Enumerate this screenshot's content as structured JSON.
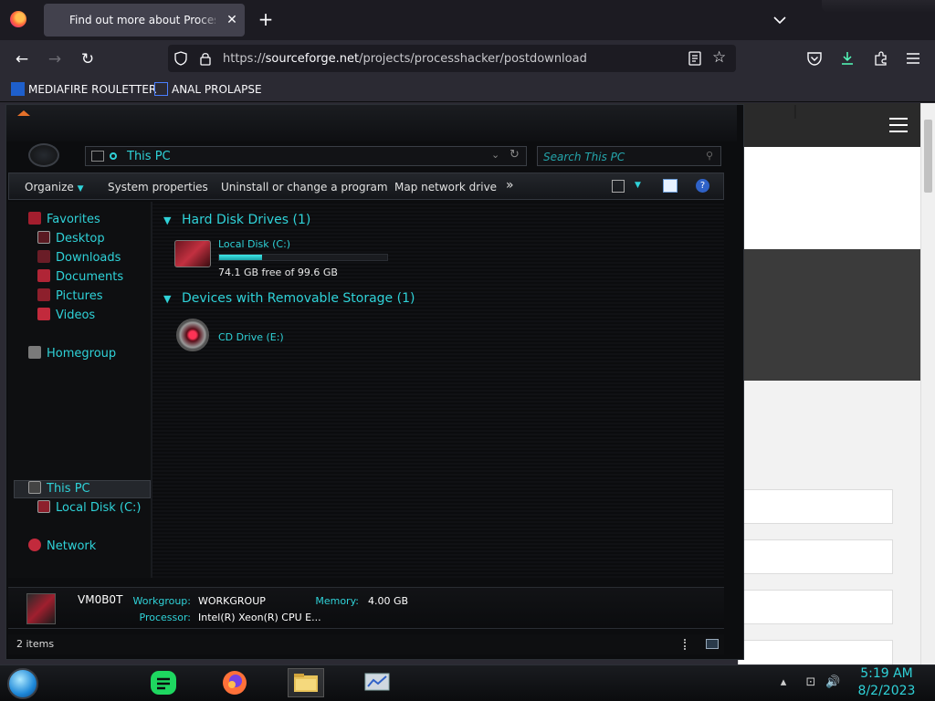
{
  "browser": {
    "tab_title": "Find out more about Process Hacker",
    "url_scheme": "https://",
    "url_host": "sourceforge.net",
    "url_path": "/projects/processhacker/postdownload",
    "bookmarks": [
      {
        "label": "MEDIAFIRE ROULETTER"
      },
      {
        "label": "ANAL PROLAPSE"
      }
    ]
  },
  "explorer": {
    "address": "This PC",
    "search_placeholder": "Search This PC",
    "toolbar": {
      "organize": "Organize",
      "system_properties": "System properties",
      "uninstall": "Uninstall or change a program",
      "map_drive": "Map network drive",
      "more": "»"
    },
    "nav": {
      "favorites": "Favorites",
      "desktop": "Desktop",
      "downloads": "Downloads",
      "documents": "Documents",
      "pictures": "Pictures",
      "videos": "Videos",
      "homegroup": "Homegroup",
      "this_pc": "This PC",
      "local_disk": "Local Disk (C:)",
      "network": "Network"
    },
    "groups": {
      "hdd": "Hard Disk Drives (1)",
      "removable": "Devices with Removable Storage (1)"
    },
    "drive_c": {
      "name": "Local Disk (C:)",
      "free_text": "74.1 GB free of 99.6 GB",
      "used_fraction": 0.256
    },
    "drive_e": {
      "name": "CD Drive (E:)"
    },
    "details": {
      "computer_name": "VM0B0T",
      "workgroup_label": "Workgroup:",
      "workgroup": "WORKGROUP",
      "memory_label": "Memory:",
      "memory": "4.00 GB",
      "processor_label": "Processor:",
      "processor": "Intel(R) Xeon(R) CPU E..."
    },
    "status": "2 items"
  },
  "taskbar": {
    "time": "5:19 AM",
    "date": "8/2/2023"
  },
  "colors": {
    "accent": "#2fd2d8",
    "browser_bg": "#2b2a33"
  }
}
